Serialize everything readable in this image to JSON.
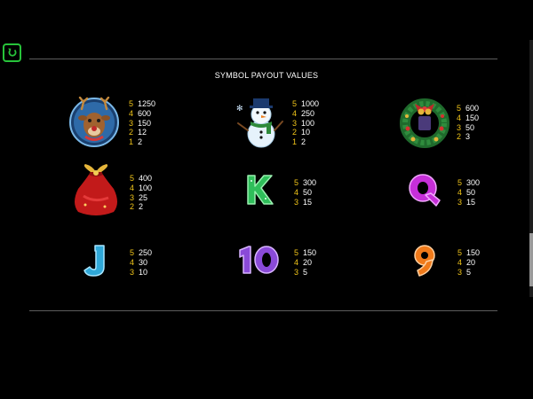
{
  "header": {
    "back_icon": "back-arrow-icon"
  },
  "title": "SYMBOL PAYOUT VALUES",
  "symbols": [
    {
      "name": "reindeer",
      "payouts": [
        {
          "count": "5",
          "value": "1250"
        },
        {
          "count": "4",
          "value": "600"
        },
        {
          "count": "3",
          "value": "150"
        },
        {
          "count": "2",
          "value": "12"
        },
        {
          "count": "1",
          "value": "2"
        }
      ]
    },
    {
      "name": "snowman",
      "payouts": [
        {
          "count": "5",
          "value": "1000"
        },
        {
          "count": "4",
          "value": "250"
        },
        {
          "count": "3",
          "value": "100"
        },
        {
          "count": "2",
          "value": "10"
        },
        {
          "count": "1",
          "value": "2"
        }
      ]
    },
    {
      "name": "wreath",
      "payouts": [
        {
          "count": "5",
          "value": "600"
        },
        {
          "count": "4",
          "value": "150"
        },
        {
          "count": "3",
          "value": "50"
        },
        {
          "count": "2",
          "value": "3"
        }
      ]
    },
    {
      "name": "gift-bag",
      "payouts": [
        {
          "count": "5",
          "value": "400"
        },
        {
          "count": "4",
          "value": "100"
        },
        {
          "count": "3",
          "value": "25"
        },
        {
          "count": "2",
          "value": "2"
        }
      ]
    },
    {
      "name": "K",
      "payouts": [
        {
          "count": "5",
          "value": "300"
        },
        {
          "count": "4",
          "value": "50"
        },
        {
          "count": "3",
          "value": "15"
        }
      ]
    },
    {
      "name": "Q",
      "payouts": [
        {
          "count": "5",
          "value": "300"
        },
        {
          "count": "4",
          "value": "50"
        },
        {
          "count": "3",
          "value": "15"
        }
      ]
    },
    {
      "name": "J",
      "payouts": [
        {
          "count": "5",
          "value": "250"
        },
        {
          "count": "4",
          "value": "30"
        },
        {
          "count": "3",
          "value": "10"
        }
      ]
    },
    {
      "name": "10",
      "payouts": [
        {
          "count": "5",
          "value": "150"
        },
        {
          "count": "4",
          "value": "20"
        },
        {
          "count": "3",
          "value": "5"
        }
      ]
    },
    {
      "name": "9",
      "payouts": [
        {
          "count": "5",
          "value": "150"
        },
        {
          "count": "4",
          "value": "20"
        },
        {
          "count": "3",
          "value": "5"
        }
      ]
    }
  ],
  "colors": {
    "accent_green": "#27c33a",
    "count_gold": "#f0c419"
  }
}
